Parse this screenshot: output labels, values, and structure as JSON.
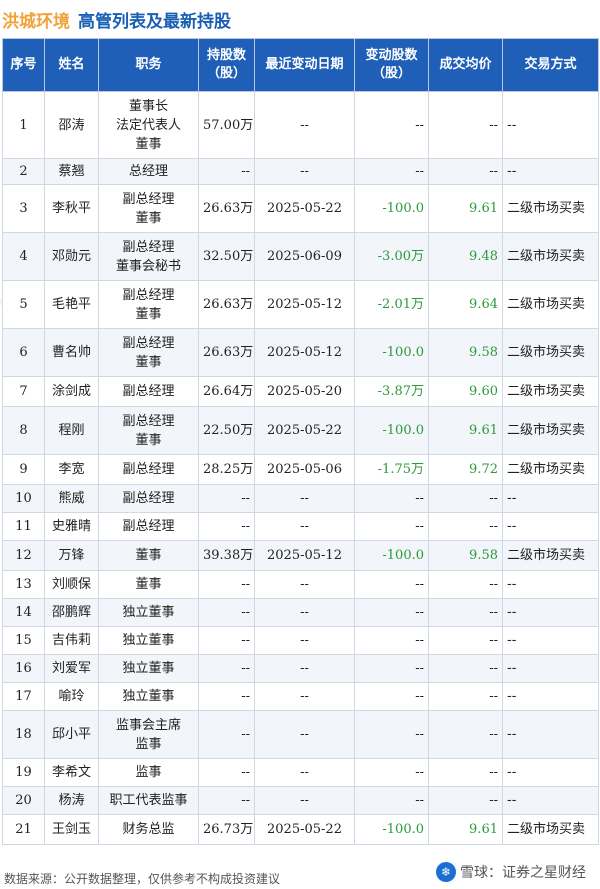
{
  "header": {
    "company": "洪城环境",
    "title": "高管列表及最新持股"
  },
  "columns": [
    "序号",
    "姓名",
    "职务",
    "持股数\n（股）",
    "最近变动日期",
    "变动股数\n（股）",
    "成交均价",
    "交易方式"
  ],
  "rows": [
    {
      "no": "1",
      "name": "邵涛",
      "roles": [
        "董事长",
        "法定代表人",
        "董事"
      ],
      "shares": "57.00万",
      "date": "--",
      "change": "--",
      "price": "--",
      "method": "--"
    },
    {
      "no": "2",
      "name": "蔡翘",
      "roles": [
        "总经理"
      ],
      "shares": "--",
      "date": "--",
      "change": "--",
      "price": "--",
      "method": "--"
    },
    {
      "no": "3",
      "name": "李秋平",
      "roles": [
        "副总经理",
        "董事"
      ],
      "shares": "26.63万",
      "date": "2025-05-22",
      "change": "-100.0",
      "price": "9.61",
      "method": "二级市场买卖"
    },
    {
      "no": "4",
      "name": "邓勋元",
      "roles": [
        "副总经理",
        "董事会秘书"
      ],
      "shares": "32.50万",
      "date": "2025-06-09",
      "change": "-3.00万",
      "price": "9.48",
      "method": "二级市场买卖"
    },
    {
      "no": "5",
      "name": "毛艳平",
      "roles": [
        "副总经理",
        "董事"
      ],
      "shares": "26.63万",
      "date": "2025-05-12",
      "change": "-2.01万",
      "price": "9.64",
      "method": "二级市场买卖"
    },
    {
      "no": "6",
      "name": "曹名帅",
      "roles": [
        "副总经理",
        "董事"
      ],
      "shares": "26.63万",
      "date": "2025-05-12",
      "change": "-100.0",
      "price": "9.58",
      "method": "二级市场买卖"
    },
    {
      "no": "7",
      "name": "涂剑成",
      "roles": [
        "副总经理"
      ],
      "shares": "26.64万",
      "date": "2025-05-20",
      "change": "-3.87万",
      "price": "9.60",
      "method": "二级市场买卖"
    },
    {
      "no": "8",
      "name": "程刚",
      "roles": [
        "副总经理",
        "董事"
      ],
      "shares": "22.50万",
      "date": "2025-05-22",
      "change": "-100.0",
      "price": "9.61",
      "method": "二级市场买卖"
    },
    {
      "no": "9",
      "name": "李宽",
      "roles": [
        "副总经理"
      ],
      "shares": "28.25万",
      "date": "2025-05-06",
      "change": "-1.75万",
      "price": "9.72",
      "method": "二级市场买卖"
    },
    {
      "no": "10",
      "name": "熊威",
      "roles": [
        "副总经理"
      ],
      "shares": "--",
      "date": "--",
      "change": "--",
      "price": "--",
      "method": "--"
    },
    {
      "no": "11",
      "name": "史雅晴",
      "roles": [
        "副总经理"
      ],
      "shares": "--",
      "date": "--",
      "change": "--",
      "price": "--",
      "method": "--"
    },
    {
      "no": "12",
      "name": "万锋",
      "roles": [
        "董事"
      ],
      "shares": "39.38万",
      "date": "2025-05-12",
      "change": "-100.0",
      "price": "9.58",
      "method": "二级市场买卖"
    },
    {
      "no": "13",
      "name": "刘顺保",
      "roles": [
        "董事"
      ],
      "shares": "--",
      "date": "--",
      "change": "--",
      "price": "--",
      "method": "--"
    },
    {
      "no": "14",
      "name": "邵鹏辉",
      "roles": [
        "独立董事"
      ],
      "shares": "--",
      "date": "--",
      "change": "--",
      "price": "--",
      "method": "--"
    },
    {
      "no": "15",
      "name": "吉伟莉",
      "roles": [
        "独立董事"
      ],
      "shares": "--",
      "date": "--",
      "change": "--",
      "price": "--",
      "method": "--"
    },
    {
      "no": "16",
      "name": "刘爱军",
      "roles": [
        "独立董事"
      ],
      "shares": "--",
      "date": "--",
      "change": "--",
      "price": "--",
      "method": "--"
    },
    {
      "no": "17",
      "name": "喻玲",
      "roles": [
        "独立董事"
      ],
      "shares": "--",
      "date": "--",
      "change": "--",
      "price": "--",
      "method": "--"
    },
    {
      "no": "18",
      "name": "邱小平",
      "roles": [
        "监事会主席",
        "监事"
      ],
      "shares": "--",
      "date": "--",
      "change": "--",
      "price": "--",
      "method": "--"
    },
    {
      "no": "19",
      "name": "李希文",
      "roles": [
        "监事"
      ],
      "shares": "--",
      "date": "--",
      "change": "--",
      "price": "--",
      "method": "--"
    },
    {
      "no": "20",
      "name": "杨涛",
      "roles": [
        "职工代表监事"
      ],
      "shares": "--",
      "date": "--",
      "change": "--",
      "price": "--",
      "method": "--"
    },
    {
      "no": "21",
      "name": "王剑玉",
      "roles": [
        "财务总监"
      ],
      "shares": "26.73万",
      "date": "2025-05-22",
      "change": "-100.0",
      "price": "9.61",
      "method": "二级市场买卖"
    }
  ],
  "footer": {
    "source": "数据来源：公开数据整理，仅供参考不构成投资建议",
    "brand": "雪球：证券之星财经",
    "brand_icon": "snowball-icon",
    "watermark": "证券之星"
  },
  "colors": {
    "header_bg": "#1f5fb8",
    "company": "#f2a23a",
    "title": "#1a5fb4",
    "positive": "#2b9a3a"
  }
}
